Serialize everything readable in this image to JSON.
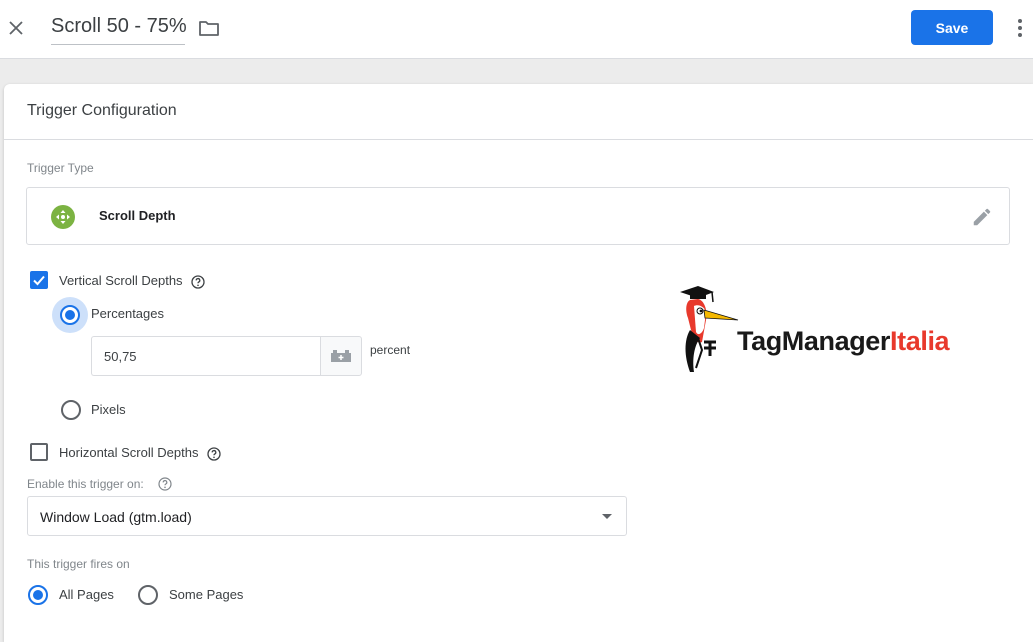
{
  "header": {
    "title": "Scroll 50 - 75%",
    "save_label": "Save"
  },
  "card": {
    "title": "Trigger Configuration",
    "trigger_type_label": "Trigger Type",
    "trigger_type_name": "Scroll Depth",
    "trigger_type_icon_color": "#7cb342"
  },
  "vertical": {
    "label": "Vertical Scroll Depths",
    "checked": true,
    "options": [
      {
        "label": "Percentages",
        "selected": true
      },
      {
        "label": "Pixels",
        "selected": false
      }
    ],
    "value": "50,75",
    "unit": "percent"
  },
  "horizontal": {
    "label": "Horizontal Scroll Depths",
    "checked": false
  },
  "enable_on": {
    "label": "Enable this trigger on:",
    "selected": "Window Load (gtm.load)"
  },
  "fires_on": {
    "label": "This trigger fires on",
    "options": [
      {
        "label": "All Pages",
        "selected": true
      },
      {
        "label": "Some Pages",
        "selected": false
      }
    ]
  },
  "logo": {
    "text_dark": "TagManager",
    "text_red": "Italia"
  },
  "colors": {
    "accent": "#1a73e8",
    "logo_red": "#e8392c"
  }
}
